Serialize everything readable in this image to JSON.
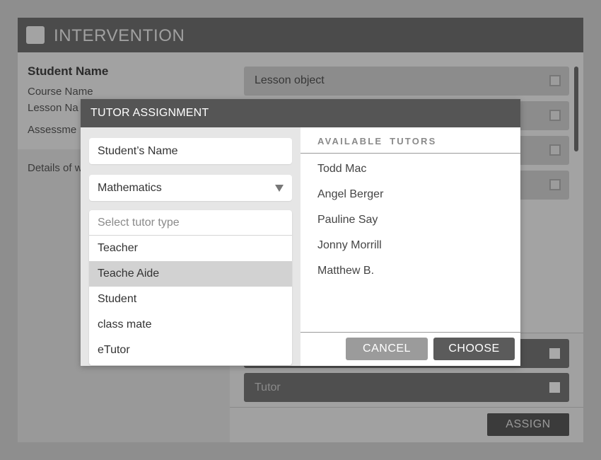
{
  "window": {
    "title": "INTERVENTION",
    "icon": "app-square-icon"
  },
  "student_info": {
    "student_name": "Student Name",
    "course_name": "Course Name",
    "lesson_name": "Lesson Na",
    "assessment": "Assessme",
    "details": "Details of wrong/righ"
  },
  "objects": {
    "items": [
      {
        "label": "Lesson object"
      },
      {
        "label": ""
      },
      {
        "label": ""
      },
      {
        "label": ""
      }
    ]
  },
  "bottom": {
    "rows": [
      {
        "label": ""
      },
      {
        "label": "Tutor"
      }
    ],
    "assign_label": "ASSIGN"
  },
  "modal": {
    "title": "TUTOR ASSIGNMENT",
    "student_name_value": "Student’s Name",
    "subject_value": "Mathematics",
    "tutor_types": [
      {
        "label": "Select tutor type"
      },
      {
        "label": "Teacher"
      },
      {
        "label": "Teache Aide"
      },
      {
        "label": "Student"
      },
      {
        "label": "class mate"
      },
      {
        "label": "eTutor"
      }
    ],
    "available_heading": "AVAILABLE TUTORS",
    "tutors": [
      {
        "name": "Todd Mac"
      },
      {
        "name": "Angel Berger"
      },
      {
        "name": "Pauline Say"
      },
      {
        "name": "Jonny Morrill"
      },
      {
        "name": "Matthew B."
      }
    ],
    "cancel_label": "CANCEL",
    "choose_label": "CHOOSE"
  },
  "colors": {
    "header_dark": "#4b4b4b",
    "modal_header": "#555555",
    "selected_row": "#d2d2d2",
    "choose_button": "#5b5b5b",
    "cancel_button": "#9b9b9b"
  }
}
